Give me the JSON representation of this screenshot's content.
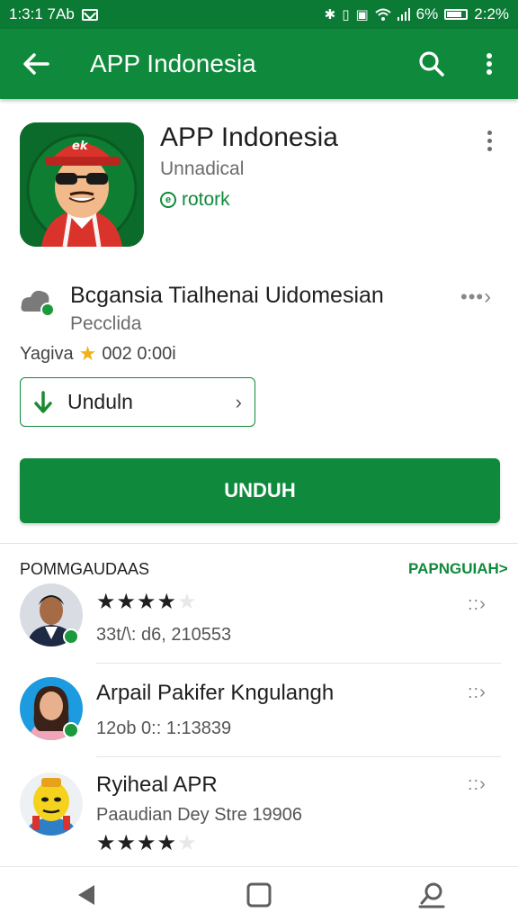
{
  "status_bar": {
    "time": "1:3:1 7Ab",
    "battery": "2:2%",
    "signal_text": "6%"
  },
  "toolbar": {
    "title": "APP Indonesia",
    "back_icon": "back-arrow-icon",
    "search_icon": "search-icon",
    "overflow_icon": "more-vert-icon"
  },
  "app": {
    "name": "APP Indonesia",
    "developer": "Unnadical",
    "badge": "rotork"
  },
  "info": {
    "title": "Bcgansia Tialhenai Uidomesian",
    "subtitle": "Pecclida",
    "rating_label": "Yagiva",
    "rating_value": "002 0:00i"
  },
  "download_outline": {
    "label": "Unduln"
  },
  "primary_button": {
    "label": "UNDUH"
  },
  "reviews_section": {
    "title": "POMMGAUDAAS",
    "link": "PAPNGUIAH>"
  },
  "reviews": [
    {
      "stars": 4,
      "meta": "33t/\\: d6, 210553"
    },
    {
      "name": "Arpail Pakifer Kngulangh",
      "meta": "12ob 0:: 1:13839"
    },
    {
      "name": "Ryiheal APR",
      "meta": "Paaudian Dey Stre 19906",
      "stars": 4
    }
  ],
  "colors": {
    "primary": "#0f8a3c",
    "status_bar": "#0b7a35",
    "star": "#f2b01e"
  }
}
